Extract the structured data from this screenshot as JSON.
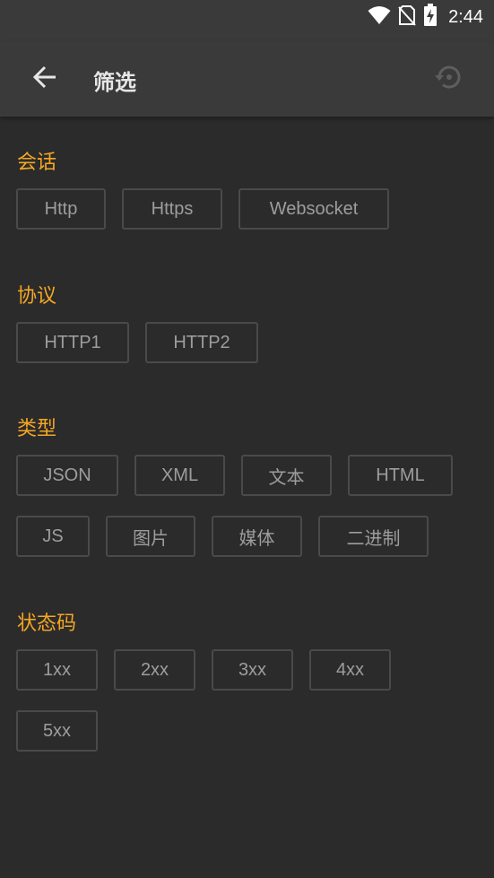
{
  "status_bar": {
    "time": "2:44",
    "icons": [
      "wifi-icon",
      "no-sim-icon",
      "battery-charging-icon"
    ],
    "color": "#ffffff"
  },
  "app_bar": {
    "title": "筛选",
    "back_icon": "arrow-back-icon",
    "reset_icon": "history-reset-icon"
  },
  "colors": {
    "background": "#2b2b2b",
    "bar": "#3a3a3a",
    "accent": "#f5a623",
    "chip_border": "#4a4a4a",
    "chip_text": "#9d9d9d"
  },
  "sections": {
    "session": {
      "title": "会话",
      "chips": [
        "Http",
        "Https",
        "Websocket"
      ]
    },
    "protocol": {
      "title": "协议",
      "chips": [
        "HTTP1",
        "HTTP2"
      ]
    },
    "type": {
      "title": "类型",
      "chips": [
        "JSON",
        "XML",
        "文本",
        "HTML",
        "JS",
        "图片",
        "媒体",
        "二进制"
      ]
    },
    "status_code": {
      "title": "状态码",
      "chips": [
        "1xx",
        "2xx",
        "3xx",
        "4xx",
        "5xx"
      ]
    }
  }
}
